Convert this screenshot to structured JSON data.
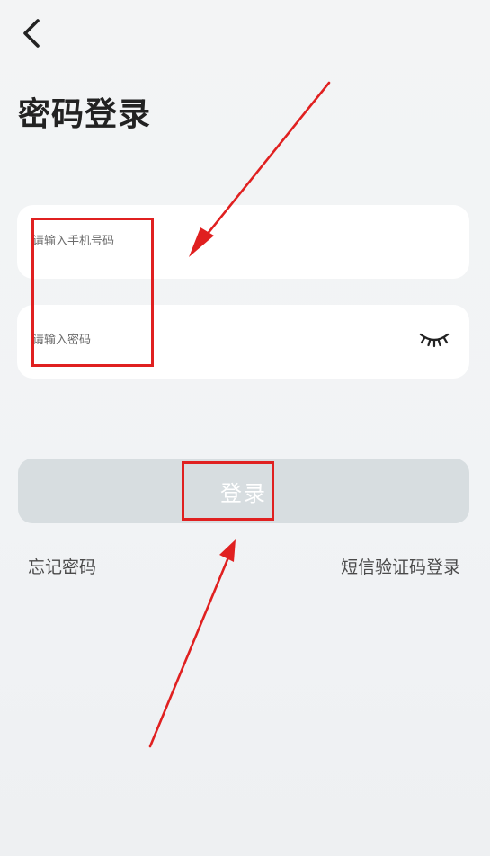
{
  "header": {
    "back_icon": "chevron-left-icon",
    "title": "密码登录"
  },
  "form": {
    "phone_placeholder": "请输入手机号码",
    "password_placeholder": "请输入密码",
    "password_toggle_icon": "eye-closed-icon",
    "login_label": "登录"
  },
  "links": {
    "forgot_password": "忘记密码",
    "sms_login": "短信验证码登录"
  },
  "annotations": {
    "color": "#e02020"
  },
  "colors": {
    "background": "#f2f4f6",
    "field_background": "#ffffff",
    "login_button": "#d7dde0",
    "login_text": "#ffffff"
  }
}
